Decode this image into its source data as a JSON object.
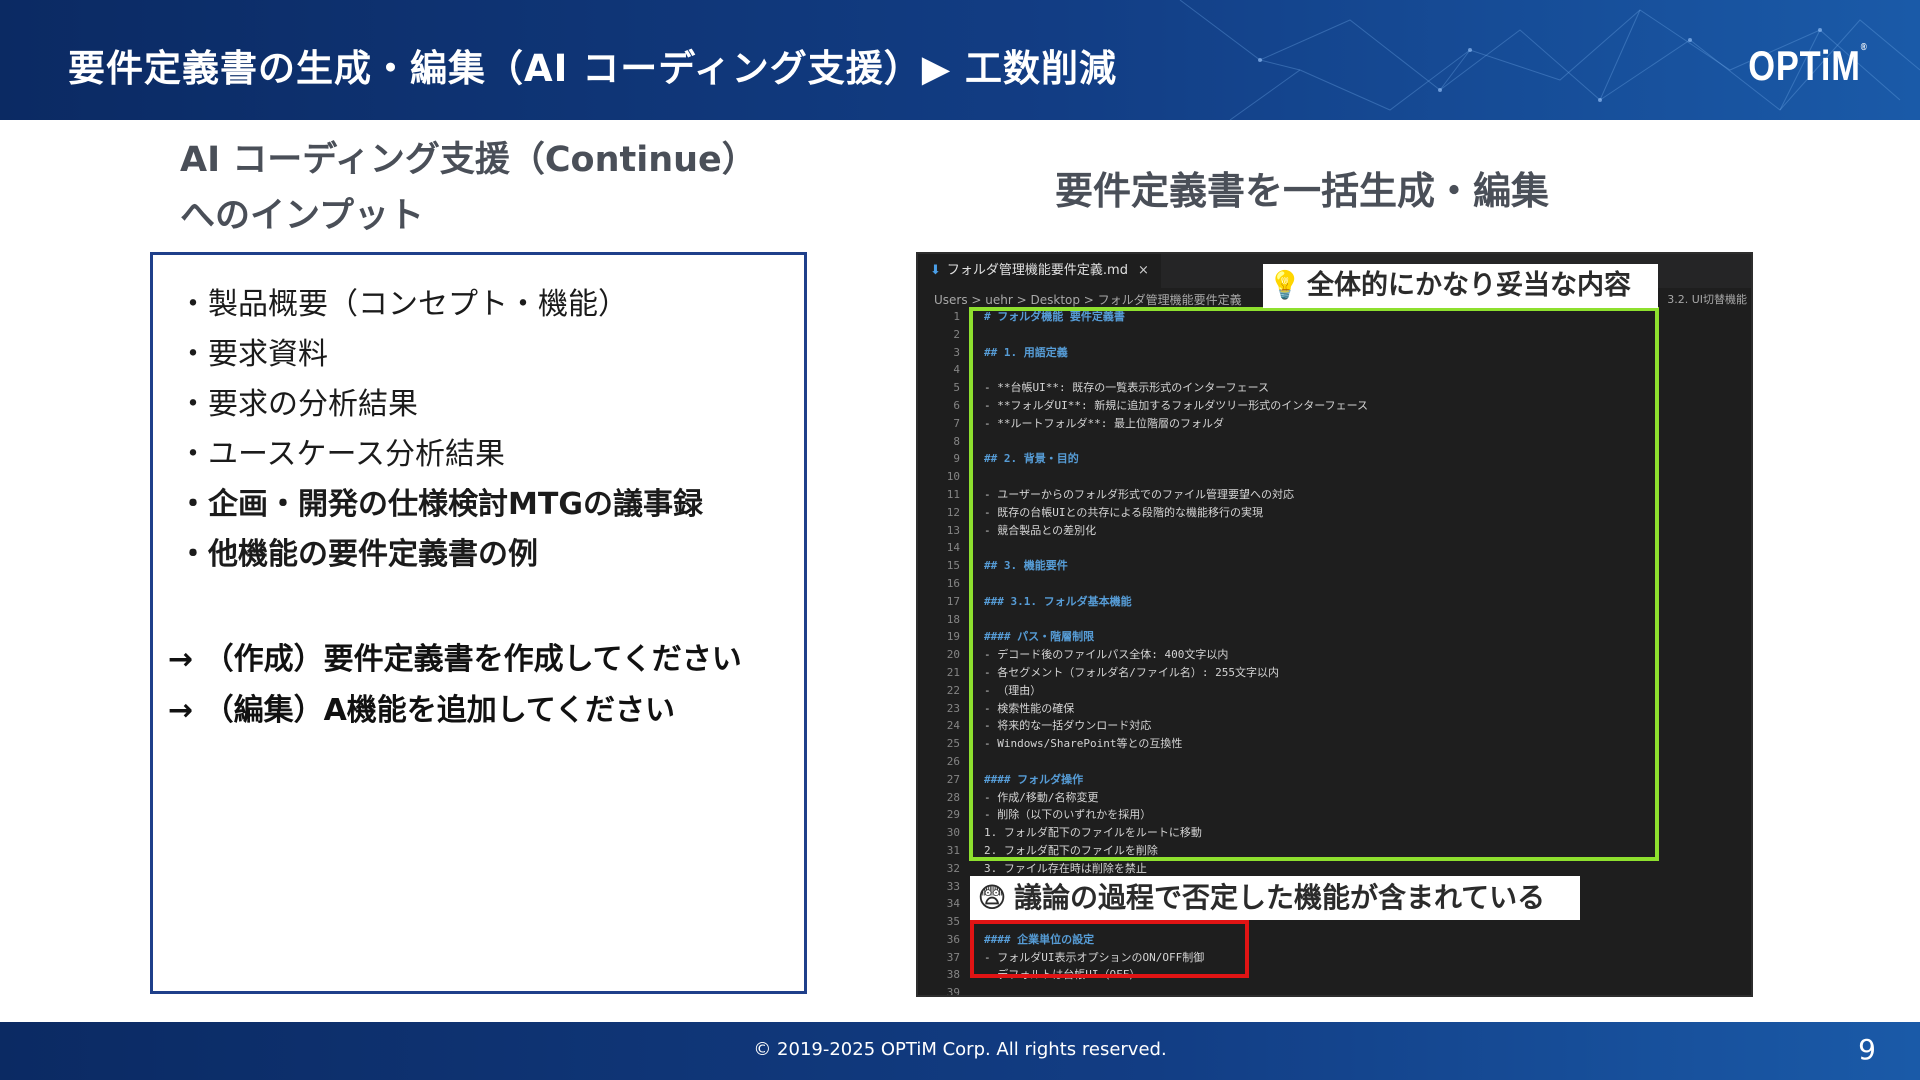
{
  "header": {
    "title": "要件定義書の生成・編集（AI コーディング支援）▶ 工数削減",
    "logo": "OPTiM",
    "logo_mark": "®"
  },
  "left": {
    "title_line1": "AI コーディング支援（Continue）",
    "title_line2": "へのインプット",
    "bullets": [
      "・製品概要（コンセプト・機能）",
      "・要求資料",
      "・要求の分析結果",
      "・ユースケース分析結果",
      "・企画・開発の仕様検討MTGの議事録",
      "・他機能の要件定義書の例"
    ],
    "instructions": [
      "→ （作成）要件定義書を作成してください",
      "→ （編集）A機能を追加してください"
    ]
  },
  "right": {
    "title": "要件定義書を一括生成・編集",
    "editor": {
      "tab_label": "フォルダ管理機能要件定義.md",
      "tab_close": "×",
      "breadcrumb": "Users > uehr > Desktop > フォルダ管理機能要件定義",
      "breadcrumb_right": "3.2. UI切替機能",
      "lines": [
        {
          "n": "1",
          "t": "# フォルダ機能 要件定義書"
        },
        {
          "n": "2",
          "t": ""
        },
        {
          "n": "3",
          "t": "## 1. 用語定義"
        },
        {
          "n": "4",
          "t": ""
        },
        {
          "n": "5",
          "t": "- **台帳UI**: 既存の一覧表示形式のインターフェース"
        },
        {
          "n": "6",
          "t": "- **フォルダUI**: 新規に追加するフォルダツリー形式のインターフェース"
        },
        {
          "n": "7",
          "t": "- **ルートフォルダ**: 最上位階層のフォルダ"
        },
        {
          "n": "8",
          "t": ""
        },
        {
          "n": "9",
          "t": "## 2. 背景・目的"
        },
        {
          "n": "10",
          "t": ""
        },
        {
          "n": "11",
          "t": "- ユーザーからのフォルダ形式でのファイル管理要望への対応"
        },
        {
          "n": "12",
          "t": "- 既存の台帳UIとの共存による段階的な機能移行の実現"
        },
        {
          "n": "13",
          "t": "- 競合製品との差別化"
        },
        {
          "n": "14",
          "t": ""
        },
        {
          "n": "15",
          "t": "## 3. 機能要件"
        },
        {
          "n": "16",
          "t": ""
        },
        {
          "n": "17",
          "t": "### 3.1. フォルダ基本機能"
        },
        {
          "n": "18",
          "t": ""
        },
        {
          "n": "19",
          "t": "#### パス・階層制限"
        },
        {
          "n": "20",
          "t": "- デコード後のファイルパス全体: 400文字以内"
        },
        {
          "n": "21",
          "t": "- 各セグメント（フォルダ名/ファイル名）: 255文字以内"
        },
        {
          "n": "22",
          "t": "- （理由）"
        },
        {
          "n": "23",
          "t": "  - 検索性能の確保"
        },
        {
          "n": "24",
          "t": "  - 将来的な一括ダウンロード対応"
        },
        {
          "n": "25",
          "t": "  - Windows/SharePoint等との互換性"
        },
        {
          "n": "26",
          "t": ""
        },
        {
          "n": "27",
          "t": "#### フォルダ操作"
        },
        {
          "n": "28",
          "t": "- 作成/移動/名称変更"
        },
        {
          "n": "29",
          "t": "- 削除（以下のいずれかを採用）"
        },
        {
          "n": "30",
          "t": "  1. フォルダ配下のファイルをルートに移動"
        },
        {
          "n": "31",
          "t": "  2. フォルダ配下のファイルを削除"
        },
        {
          "n": "32",
          "t": "  3. ファイル存在時は削除を禁止"
        },
        {
          "n": "33",
          "t": ""
        },
        {
          "n": "34",
          "t": ""
        },
        {
          "n": "35",
          "t": ""
        },
        {
          "n": "36",
          "t": "#### 企業単位の設定"
        },
        {
          "n": "37",
          "t": "- フォルダUI表示オプションのON/OFF制御"
        },
        {
          "n": "38",
          "t": "- デフォルトは台帳UI（OFF）"
        },
        {
          "n": "39",
          "t": ""
        }
      ]
    },
    "callout_good": {
      "icon": "💡",
      "text": "全体的にかなり妥当な内容"
    },
    "callout_bad": {
      "icon": "😨",
      "text": "議論の過程で否定した機能が含まれている"
    }
  },
  "colors": {
    "header_bg": "#0b2a63",
    "box_border": "#1f3f8a",
    "green_highlight": "#8ee02e",
    "red_highlight": "#e01414",
    "editor_bg": "#1e1e1e"
  },
  "footer": {
    "copyright": "© 2019-2025 OPTiM Corp. All rights reserved.",
    "page_number": "9"
  }
}
